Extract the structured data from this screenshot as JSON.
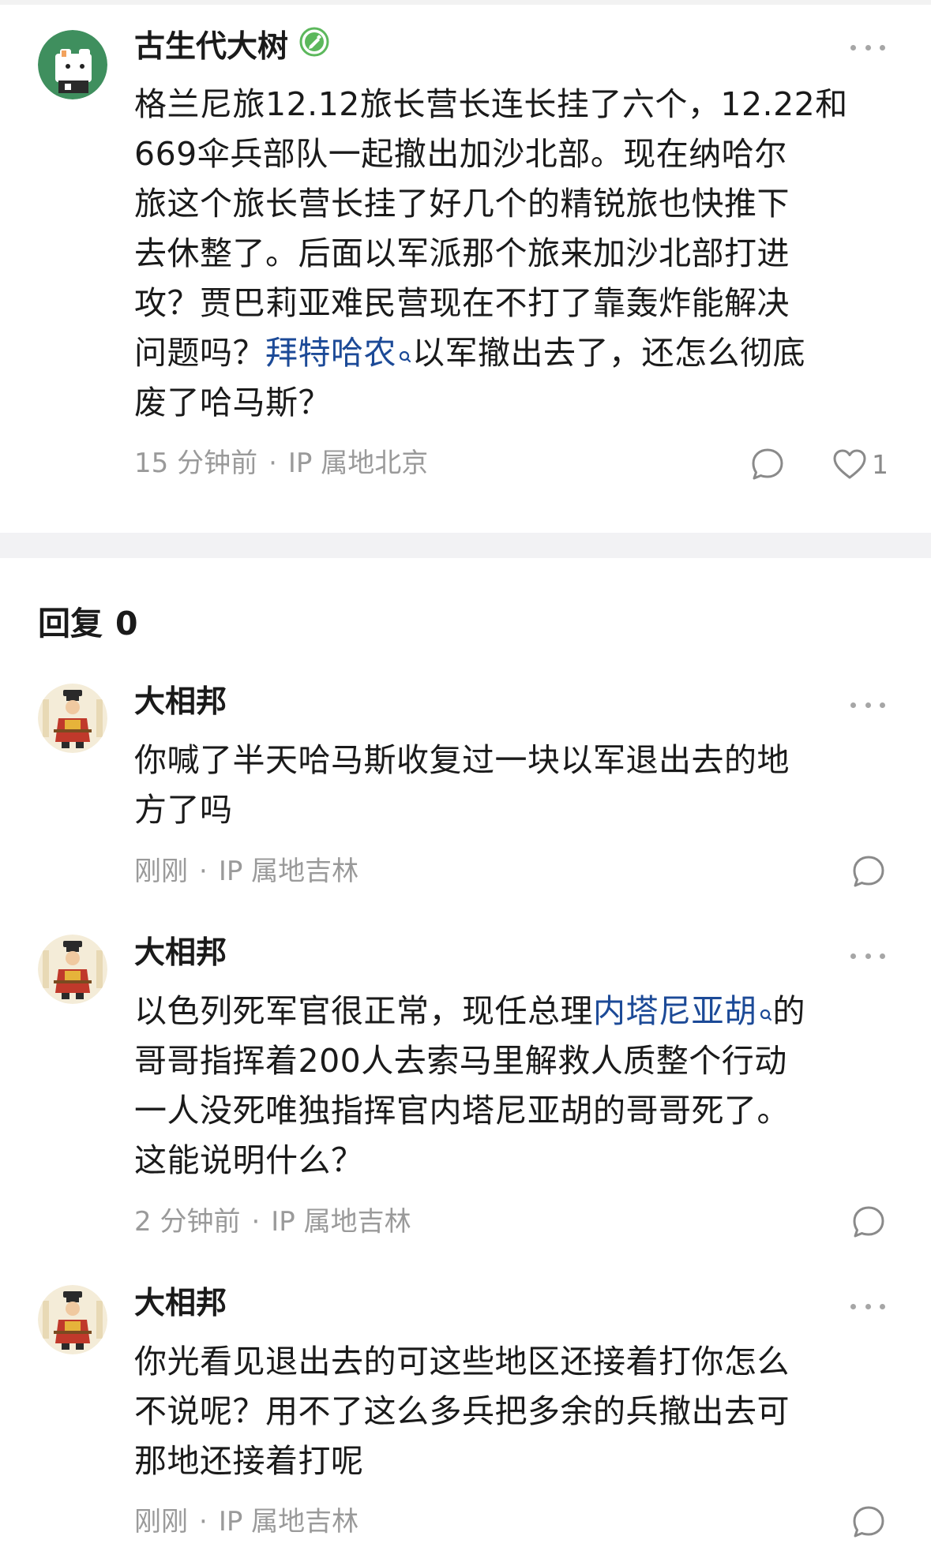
{
  "main_post": {
    "username": "古生代大树",
    "verified_badge": "green-verified-badge-icon",
    "lines": [
      [
        "格兰尼旅12.12旅长营长连长挂了六个，12.22和"
      ],
      [
        "669伞兵部队一起撤出加沙北部。现在纳哈尔"
      ],
      [
        "旅这个旅长营长挂了好几个的精锐旅也快推下"
      ],
      [
        "去休整了。后面以军派那个旅来加沙北部打进"
      ],
      [
        "攻？贾巴莉亚难民营现在不打了靠轰炸能解决"
      ],
      [
        "问题吗？",
        "拜特哈农",
        "以军撤出去了，还怎么彻底"
      ],
      [
        "废了哈马斯？"
      ]
    ],
    "time": "15 分钟前",
    "separator_dot": "·",
    "ip_location": "IP 属地北京",
    "like_count": "1"
  },
  "replies_header": {
    "label": "回复",
    "count": "0"
  },
  "replies": [
    {
      "username": "大相邦",
      "lines": [
        [
          "你喊了半天哈马斯收复过一块以军退出去的地"
        ],
        [
          "方了吗"
        ]
      ],
      "time": "刚刚",
      "separator_dot": "·",
      "ip_location": "IP 属地吉林"
    },
    {
      "username": "大相邦",
      "lines": [
        [
          "以色列死军官很正常，现任总理",
          "内塔尼亚胡",
          "的"
        ],
        [
          "哥哥指挥着200人去索马里解救人质整个行动"
        ],
        [
          "一人没死唯独指挥官内塔尼亚胡的哥哥死了。"
        ],
        [
          "这能说明什么？"
        ]
      ],
      "time": "2 分钟前",
      "separator_dot": "·",
      "ip_location": "IP 属地吉林"
    },
    {
      "username": "大相邦",
      "lines": [
        [
          "你光看见退出去的可这些地区还接着打你怎么"
        ],
        [
          "不说呢？用不了这么多兵把多余的兵撤出去可"
        ],
        [
          "那地还接着打呢"
        ]
      ],
      "time": "刚刚",
      "separator_dot": "·",
      "ip_location": "IP 属地吉林"
    }
  ],
  "icons": {
    "more": "more-horizontal-icon",
    "comment": "comment-bubble-icon",
    "like": "heart-outline-icon",
    "link_search": "search-magnifier-icon"
  },
  "colors": {
    "link": "#1c4a97",
    "meta_text": "#9a9a9a",
    "badge_green": "#5cb85c",
    "separator": "#f2f2f4"
  }
}
